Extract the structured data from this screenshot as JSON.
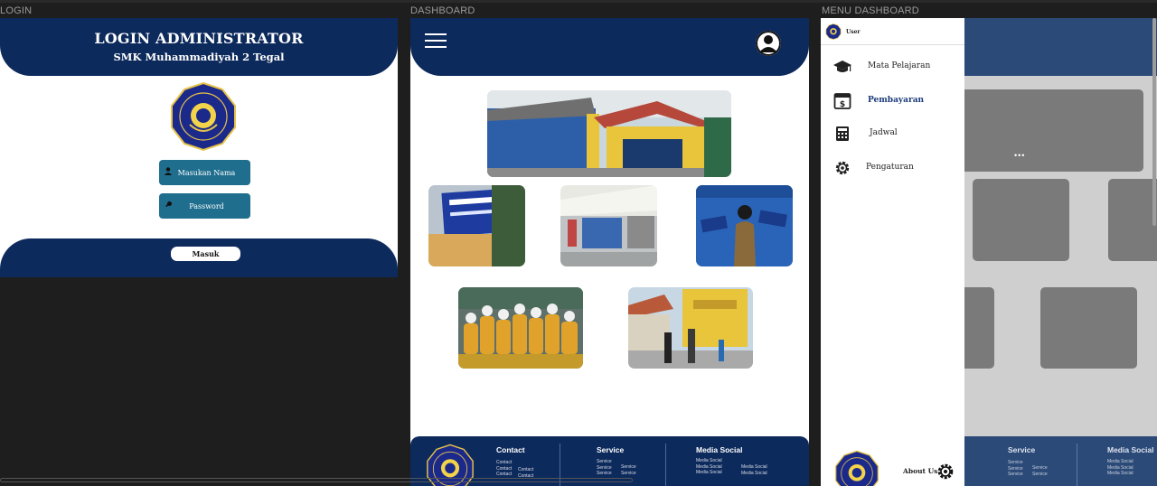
{
  "frames": {
    "login_label": "LOGIN",
    "dashboard_label": "DASHBOARD",
    "menu_label": "MENU DASHBOARD"
  },
  "login": {
    "title": "LOGIN ADMINISTRATOR",
    "subtitle": "SMK Muhammadiyah 2 Tegal",
    "name_placeholder": "Masukan Nama",
    "password_placeholder": "Password",
    "submit_label": "Masuk"
  },
  "dashboard": {
    "footer": {
      "contact_title": "Contact",
      "contact_items": [
        "Contact",
        "Contact",
        "Contact"
      ],
      "contact_items_2": [
        "Contact",
        "Contact"
      ],
      "service_title": "Service",
      "service_items": [
        "Service",
        "Service",
        "Service"
      ],
      "service_items_2": [
        "Service",
        "Service"
      ],
      "social_title": "Media Social",
      "social_items": [
        "Media Social",
        "Media Social",
        "Media Social"
      ],
      "social_items_2": [
        "Media Social",
        "Media Social"
      ]
    }
  },
  "menu": {
    "user_label": "User",
    "items": [
      {
        "label": "Mata Pelajaran",
        "icon": "graduation-cap-icon"
      },
      {
        "label": "Pembayaran",
        "icon": "payment-dollar-icon"
      },
      {
        "label": "Jadwal",
        "icon": "calculator-icon"
      },
      {
        "label": "Pengaturan",
        "icon": "gear-icon"
      }
    ],
    "about_label": "About Us",
    "bg_ellipsis": "•••",
    "bg_footer_service": "Service",
    "bg_footer_social": "Media Social",
    "bg_service_items": [
      "Service",
      "Service",
      "Service"
    ],
    "bg_service_items_2": [
      "Service",
      "Service"
    ],
    "bg_social_items": [
      "Media Social",
      "Media Social",
      "Media Social"
    ]
  },
  "colors": {
    "navy": "#0d2a5c",
    "teal_input": "#1f6e8e",
    "active_menu": "#1b3a7a"
  }
}
